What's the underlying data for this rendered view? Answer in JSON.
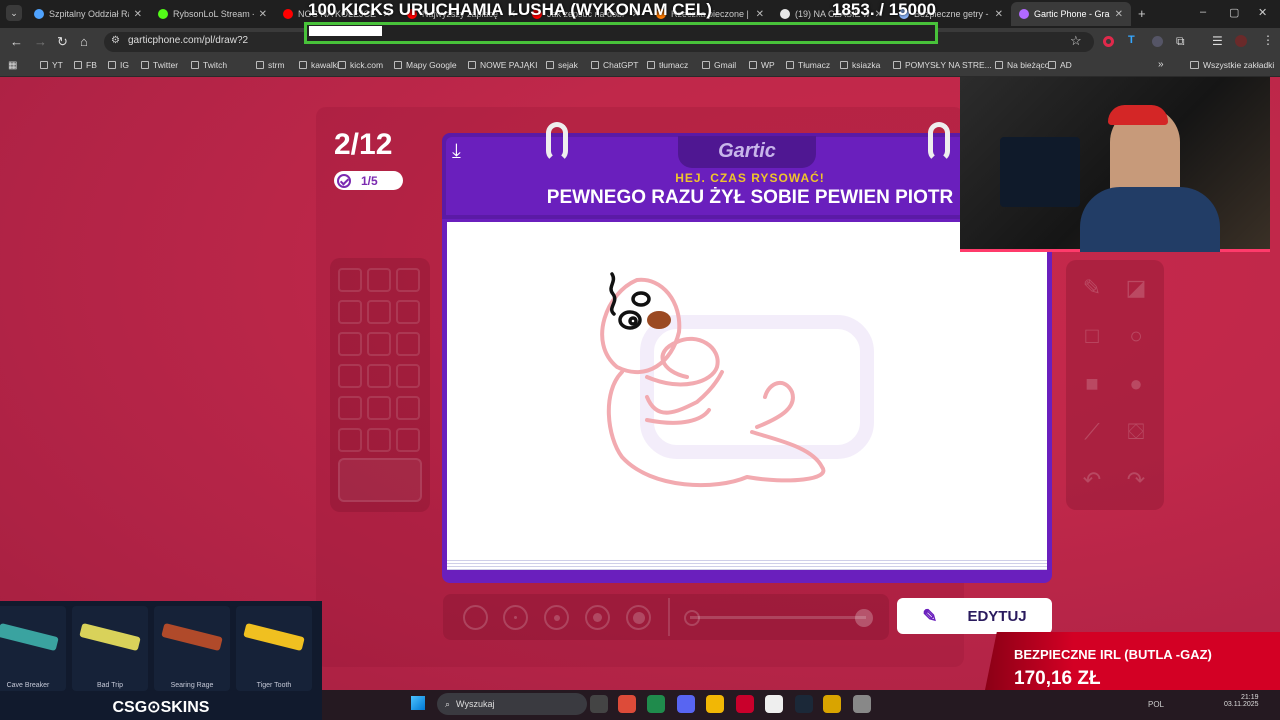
{
  "browser": {
    "tabs": [
      {
        "label": "Szpitalny Oddział Ra",
        "color": "#4fa3ff",
        "active": false
      },
      {
        "label": "RybsonLoL Stream - ",
        "color": "#53fc18",
        "active": false
      },
      {
        "label": "NOC NA KOLEJCE",
        "color": "#ff0000",
        "active": false
      },
      {
        "label": "Najwyższy zapłacę",
        "color": "#ff0000",
        "active": false
      },
      {
        "label": "Jak zepsuć na dobr",
        "color": "#ff0000",
        "active": false
      },
      {
        "label": "Rzeczka pieczone | A",
        "color": "#ff7a00",
        "active": false
      },
      {
        "label": "(19) NA CZASIE w",
        "color": "#e7e7e7",
        "active": false
      },
      {
        "label": "Bezpieczne getry - S",
        "color": "#8ab4f8",
        "active": false
      },
      {
        "label": "Gartic Phone - Gra w",
        "color": "#b169ff",
        "active": true
      }
    ],
    "url": "garticphone.com/pl/draw?2",
    "bookmarks": [
      "YT",
      "FB",
      "IG",
      "Twitter",
      "Twitch",
      "strm",
      "kawalki",
      "kick.com",
      "Mapy Google",
      "NOWE PAJĄKI",
      "sejak",
      "ChatGPT",
      "tłumacz",
      "Gmail",
      "WP",
      "Tłumacz",
      "ksiazka",
      "POMYSŁY NA STRE...",
      "Na bieżąco",
      "AD"
    ],
    "all_bookmarks": "Wszystkie zakładki"
  },
  "overlay": {
    "title": "100 KICKS URUCHAMIA LUSHA (WYKONAM CEL)",
    "count": "1853. / 15000",
    "progress": 0.12
  },
  "game": {
    "counter": "2/12",
    "done": "1/5",
    "logo": "Gartic",
    "subtitle": "HEJ. CZAS RYSOWAĆ!",
    "prompt": "PEWNEGO RAZU ŻYŁ SOBIE PEWIEN PIOTR",
    "edit_button": "EDYTUJ",
    "tool_icons": [
      "pencil-icon",
      "eraser-icon",
      "square-icon",
      "circle-icon",
      "filled-square-icon",
      "filled-circle-icon",
      "line-icon",
      "bucket-icon",
      "undo-icon",
      "redo-icon"
    ]
  },
  "csgo": {
    "skins": [
      {
        "name": "Cave Breaker",
        "color": "#3aa3a0"
      },
      {
        "name": "Bad Trip",
        "color": "#d9d25a"
      },
      {
        "name": "Searing Rage",
        "color": "#b04a2a"
      },
      {
        "name": "Tiger Tooth",
        "color": "#f0c020"
      }
    ],
    "logo": "CSG⊙SKINS"
  },
  "taskbar": {
    "search": "Wyszukaj",
    "lang": "POL",
    "time": "21:19",
    "date": "03.11.2025"
  },
  "donation": {
    "title": "BEZPIECZNE IRL (BUTLA -GAZ)",
    "amount": "170,16 ZŁ"
  }
}
